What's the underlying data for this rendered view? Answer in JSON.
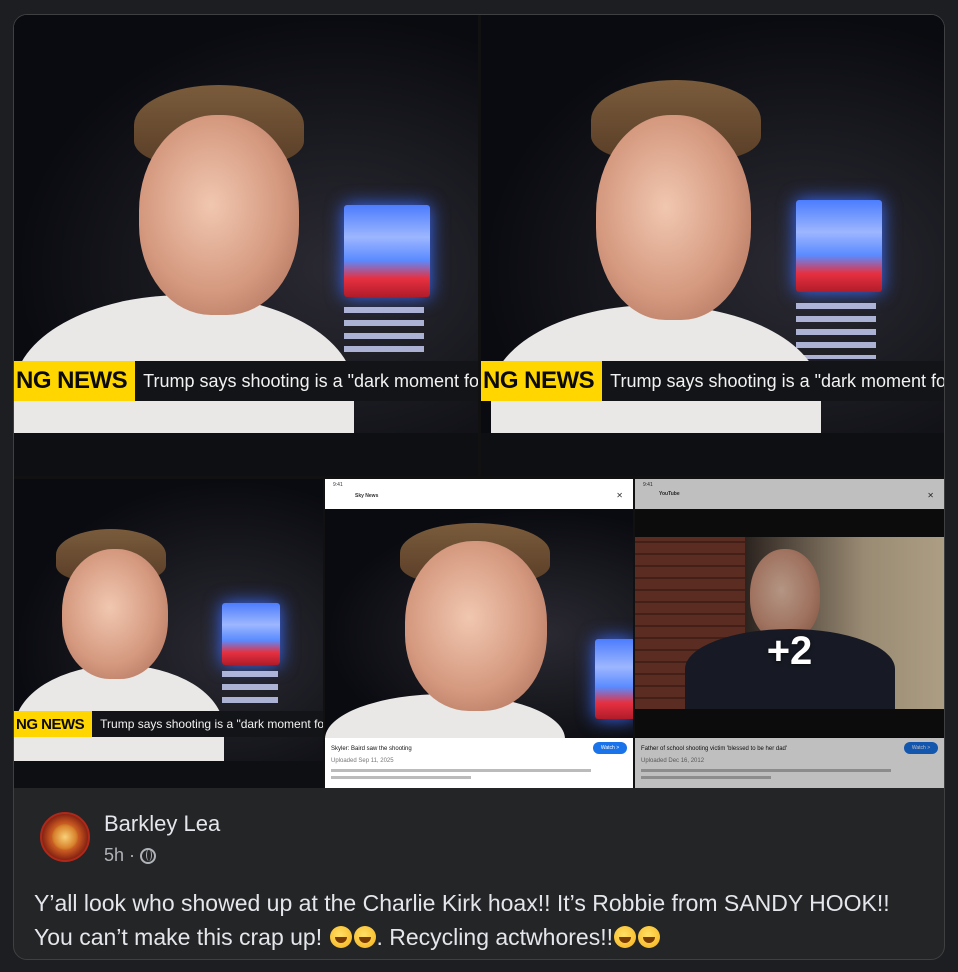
{
  "post": {
    "author": "Barkley Lea",
    "time": "5h",
    "separator": "·",
    "audience_icon": "globe-icon",
    "text_line1": "Y’all look who showed up at the Charlie Kirk hoax!! It’s Robbie from SANDY HOOK!!",
    "text_line2_a": "You can’t make this crap up!",
    "text_line2_b": ". Recycling actwhores!!",
    "emoji": "rolling-on-floor-laughing"
  },
  "media": {
    "more_count": "+2",
    "lower_third_brand": "NG NEWS",
    "lower_third_headline": "Trump says shooting is a \"dark moment for A",
    "phone1": {
      "app": "Sky News",
      "video_title": "Skyler: Baird saw the shooting",
      "uploaded": "Uploaded Sep 11, 2025",
      "watch": "Watch >"
    },
    "phone2": {
      "app": "YouTube",
      "video_title": "Father of school shooting victim 'blessed to be her dad'",
      "uploaded": "Uploaded Dec 16, 2012",
      "watch": "Watch >"
    }
  },
  "colors": {
    "background": "#1c1e21",
    "card": "#242526",
    "text_primary": "#e4e6eb",
    "text_secondary": "#b0b3b8",
    "brand_yellow": "#ffd600"
  }
}
